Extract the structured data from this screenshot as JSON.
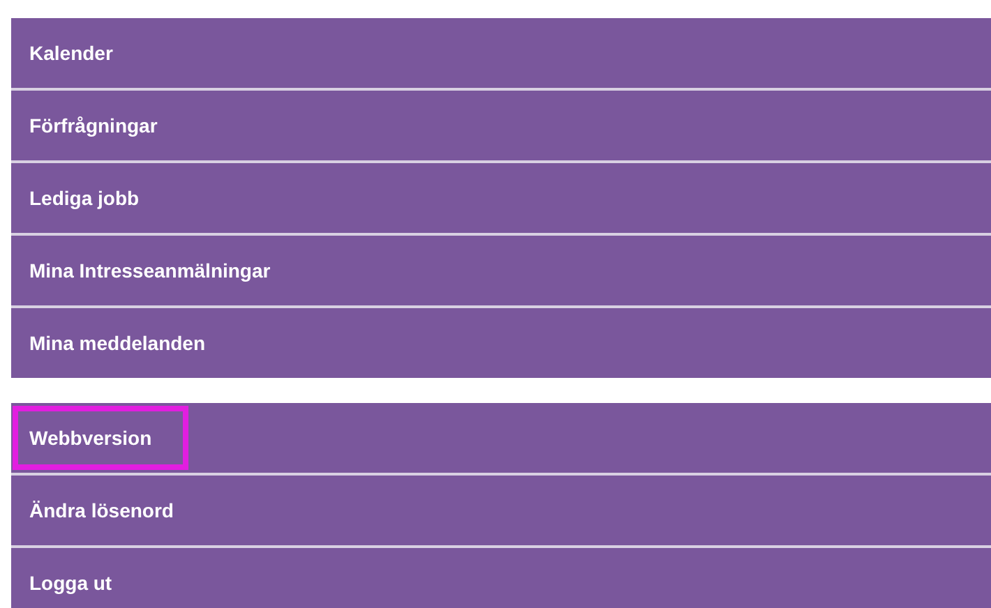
{
  "menu_groups": [
    {
      "items": [
        {
          "label": "Kalender",
          "highlighted": false
        },
        {
          "label": "Förfrågningar",
          "highlighted": false
        },
        {
          "label": "Lediga jobb",
          "highlighted": false
        },
        {
          "label": "Mina Intresseanmälningar",
          "highlighted": false
        },
        {
          "label": "Mina meddelanden",
          "highlighted": false
        }
      ]
    },
    {
      "items": [
        {
          "label": "Webbversion",
          "highlighted": true
        },
        {
          "label": "Ändra lösenord",
          "highlighted": false
        },
        {
          "label": "Logga ut",
          "highlighted": false
        }
      ]
    }
  ]
}
